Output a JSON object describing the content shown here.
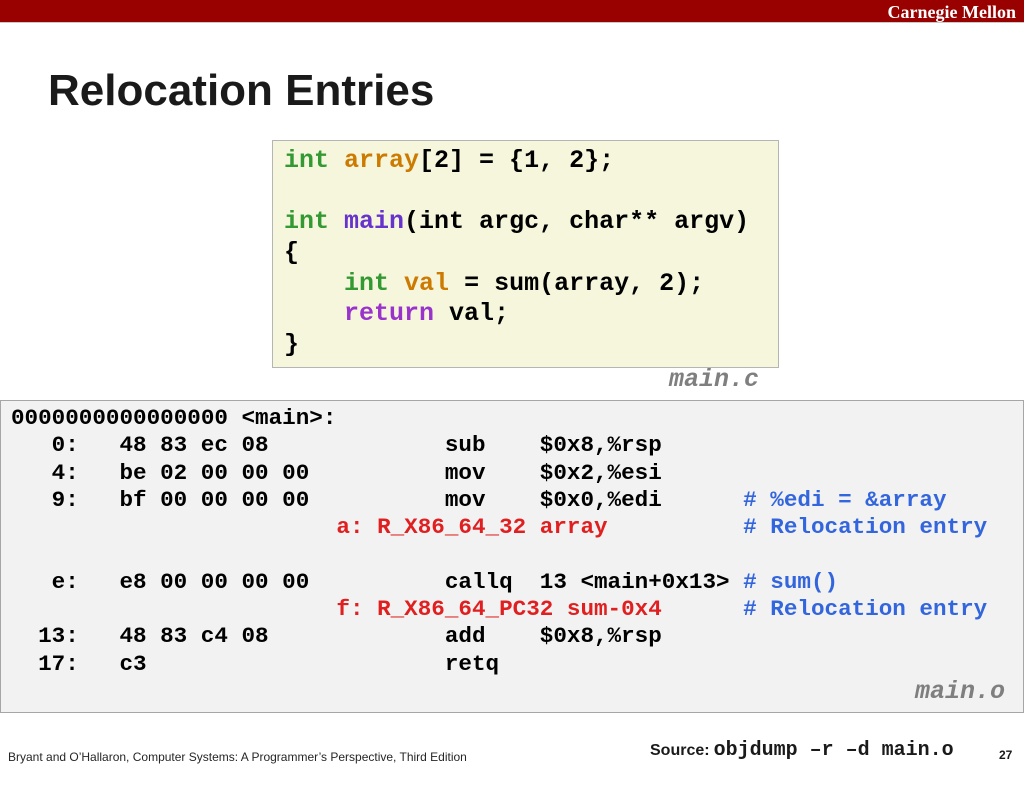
{
  "header": {
    "institution": "Carnegie Mellon",
    "brand_color": "#990000"
  },
  "slide": {
    "title": "Relocation Entries",
    "page_number": "27"
  },
  "source_code": {
    "file_label": "main.c",
    "lines": [
      [
        {
          "text": "int",
          "color": "#339933"
        },
        {
          "text": " "
        },
        {
          "text": "array",
          "color": "#cc7a00"
        },
        {
          "text": "[2] = {1, 2};"
        }
      ],
      [],
      [
        {
          "text": "int",
          "color": "#339933"
        },
        {
          "text": " "
        },
        {
          "text": "main",
          "color": "#6633cc"
        },
        {
          "text": "(int argc, char** argv)"
        }
      ],
      [
        {
          "text": "{"
        }
      ],
      [
        {
          "text": "    "
        },
        {
          "text": "int",
          "color": "#339933"
        },
        {
          "text": " "
        },
        {
          "text": "val",
          "color": "#cc7a00"
        },
        {
          "text": " = sum(array, 2);"
        }
      ],
      [
        {
          "text": "    "
        },
        {
          "text": "return",
          "color": "#9933cc"
        },
        {
          "text": " val;"
        }
      ],
      [
        {
          "text": "}"
        }
      ]
    ]
  },
  "disassembly": {
    "header": "0000000000000000 <main>:",
    "colors": {
      "relocation": "#e02020",
      "comment": "#3366dd"
    },
    "rows": [
      {
        "address": "0:",
        "bytes": "48 83 ec 08",
        "mnemonic": "sub",
        "operands": "$0x8,%rsp"
      },
      {
        "address": "4:",
        "bytes": "be 02 00 00 00",
        "mnemonic": "mov",
        "operands": "$0x2,%esi"
      },
      {
        "address": "9:",
        "bytes": "bf 00 00 00 00",
        "mnemonic": "mov",
        "operands": "$0x0,%edi",
        "comment": "# %edi = &array"
      },
      {
        "relocation": "a: R_X86_64_32 array",
        "comment": "# Relocation entry"
      },
      {
        "address": "e:",
        "bytes": "e8 00 00 00 00",
        "mnemonic": "callq",
        "operands": "13 <main+0x13>",
        "comment": "# sum()"
      },
      {
        "relocation": "f: R_X86_64_PC32 sum-0x4",
        "comment": "# Relocation entry"
      },
      {
        "address": "13:",
        "bytes": "48 83 c4 08",
        "mnemonic": "add",
        "operands": "$0x8,%rsp"
      },
      {
        "address": "17:",
        "bytes": "c3",
        "mnemonic": "retq"
      }
    ],
    "file_label": "main.o"
  },
  "footer": {
    "citation": "Bryant and O’Hallaron, Computer Systems: A Programmer’s Perspective, Third Edition",
    "source_label": "Source:",
    "source_command": "objdump –r –d main.o"
  }
}
